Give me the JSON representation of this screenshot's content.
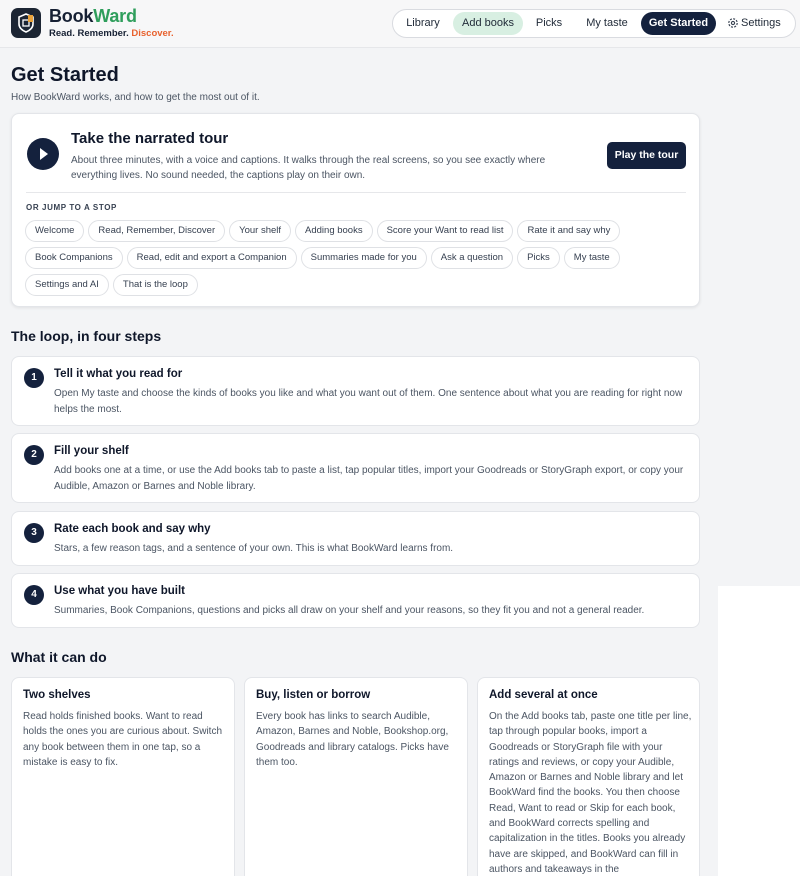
{
  "brand": {
    "name_part1": "Book",
    "name_part2": "Ward",
    "tagline_part1": "Read. Remember. ",
    "tagline_part2": "Discover."
  },
  "nav": {
    "library": "Library",
    "add_books": "Add books",
    "picks": "Picks",
    "my_taste": "My taste",
    "get_started": "Get Started",
    "settings": "Settings"
  },
  "page": {
    "title": "Get Started",
    "subtitle": "How BookWard works, and how to get the most out of it."
  },
  "tour": {
    "title": "Take the narrated tour",
    "description": "About three minutes, with a voice and captions. It walks through the real screens, so you see exactly where everything lives. No sound needed, the captions play on their own.",
    "play_button": "Play the tour",
    "jump_label": "OR JUMP TO A STOP",
    "stop_rows": [
      [
        "Welcome",
        "Read, Remember, Discover",
        "Your shelf",
        "Adding books",
        "Score your Want to read list",
        "Rate it and say why"
      ],
      [
        "Book Companions",
        "Read, edit and export a Companion",
        "Summaries made for you",
        "Ask a question",
        "Picks",
        "My taste"
      ],
      [
        "Settings and AI",
        "That is the loop"
      ]
    ]
  },
  "loop": {
    "heading": "The loop, in four steps",
    "steps": [
      {
        "number": "1",
        "title": "Tell it what you read for",
        "text": "Open My taste and choose the kinds of books you like and what you want out of them. One sentence about what you are reading for right now helps the most."
      },
      {
        "number": "2",
        "title": "Fill your shelf",
        "text": "Add books one at a time, or use the Add books tab to paste a list, tap popular titles, import your Goodreads or StoryGraph export, or copy your Audible, Amazon or Barnes and Noble library."
      },
      {
        "number": "3",
        "title": "Rate each book and say why",
        "text": "Stars, a few reason tags, and a sentence of your own. This is what BookWard learns from."
      },
      {
        "number": "4",
        "title": "Use what you have built",
        "text": "Summaries, Book Companions, questions and picks all draw on your shelf and your reasons, so they fit you and not a general reader."
      }
    ]
  },
  "features": {
    "heading": "What it can do",
    "cards": [
      {
        "title": "Two shelves",
        "text": "Read holds finished books. Want to read holds the ones you are curious about. Switch any book between them in one tap, so a mistake is easy to fix."
      },
      {
        "title": "Buy, listen or borrow",
        "text": "Every book has links to search Audible, Amazon, Barnes and Noble, Bookshop.org, Goodreads and library catalogs. Picks have them too."
      },
      {
        "title": "Add several at once",
        "text": "On the Add books tab, paste one title per line, tap through popular books, import a Goodreads or StoryGraph file with your ratings and reviews, or copy your Audible, Amazon or Barnes and Noble library and let BookWard find the books. You then choose Read, Want to read or Skip for each book, and BookWard corrects spelling and capitalization in the titles. Books you already have are skipped, and BookWard can fill in authors and takeaways in the"
      }
    ]
  }
}
